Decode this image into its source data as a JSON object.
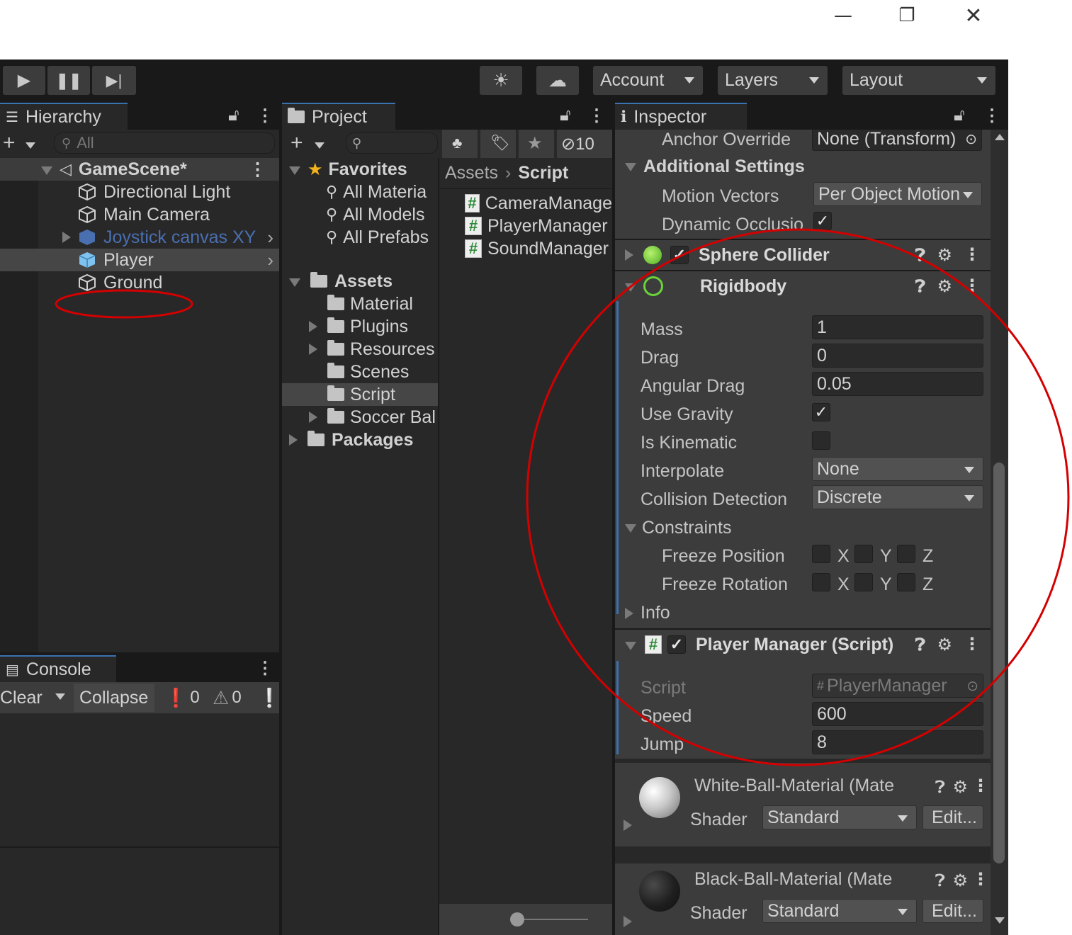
{
  "window": {
    "minimize_icon": "minimize-icon",
    "restore_icon": "restore-icon",
    "close_icon": "close-icon"
  },
  "toolbar": {
    "play_icon": "play-icon",
    "pause_icon": "pause-icon",
    "step_icon": "step-icon",
    "services_icon": "services-icon",
    "cloud_icon": "cloud-icon",
    "account": "Account",
    "layers": "Layers",
    "layout": "Layout"
  },
  "hierarchy": {
    "tab": "Hierarchy",
    "search_placeholder": "All",
    "scene": "GameScene*",
    "items": [
      {
        "label": "Directional Light"
      },
      {
        "label": "Main Camera"
      },
      {
        "label": "Joystick canvas XY"
      },
      {
        "label": "Player"
      },
      {
        "label": "Ground"
      }
    ]
  },
  "console": {
    "tab": "Console",
    "clear": "Clear",
    "collapse": "Collapse",
    "error_count": "0",
    "warning_count": "0"
  },
  "project": {
    "tab": "Project",
    "hidden_count": "10",
    "favorites": "Favorites",
    "favorite_items": [
      "All Materia",
      "All Models",
      "All Prefabs"
    ],
    "assets": "Assets",
    "asset_folders": [
      "Material",
      "Plugins",
      "Resources",
      "Scenes",
      "Script",
      "Soccer Bal"
    ],
    "packages": "Packages",
    "breadcrumb": {
      "root": "Assets",
      "current": "Script"
    },
    "files": [
      "CameraManage",
      "PlayerManager",
      "SoundManager"
    ]
  },
  "inspector": {
    "tab": "Inspector",
    "anchor_override_label": "Anchor Override",
    "anchor_override_value": "None (Transform)",
    "additional_settings": "Additional Settings",
    "motion_vectors_label": "Motion Vectors",
    "motion_vectors_value": "Per Object Motion",
    "dynamic_occlusion_label": "Dynamic Occlusio",
    "sphere_collider": "Sphere Collider",
    "rigidbody": {
      "title": "Rigidbody",
      "mass_label": "Mass",
      "mass": "1",
      "drag_label": "Drag",
      "drag": "0",
      "angular_drag_label": "Angular Drag",
      "angular_drag": "0.05",
      "use_gravity_label": "Use Gravity",
      "is_kinematic_label": "Is Kinematic",
      "interpolate_label": "Interpolate",
      "interpolate": "None",
      "collision_label": "Collision Detection",
      "collision": "Discrete",
      "constraints": "Constraints",
      "freeze_position": "Freeze Position",
      "freeze_rotation": "Freeze Rotation",
      "x": "X",
      "y": "Y",
      "z": "Z",
      "info": "Info"
    },
    "player_manager": {
      "title": "Player Manager (Script)",
      "script_label": "Script",
      "script_value": "PlayerManager",
      "speed_label": "Speed",
      "speed": "600",
      "jump_label": "Jump",
      "jump": "8"
    },
    "materials": [
      {
        "name": "White-Ball-Material (Mate",
        "shader_label": "Shader",
        "shader": "Standard",
        "edit": "Edit..."
      },
      {
        "name": "Black-Ball-Material (Mate",
        "shader_label": "Shader",
        "shader": "Standard",
        "edit": "Edit..."
      }
    ]
  },
  "colors": {
    "annotation": "#d40000",
    "accent": "#3a72b0",
    "selection": "#2c5d87"
  }
}
